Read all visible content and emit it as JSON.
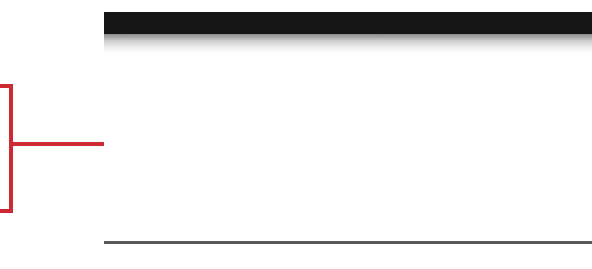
{
  "app": {
    "topbar": {
      "left_title": "",
      "left_subtitle": "",
      "right_text": ""
    },
    "center_links": [
      {
        "label": ""
      },
      {
        "label": ""
      }
    ],
    "footer": {
      "left_text": "",
      "right_text": ""
    }
  },
  "colors": {
    "callout": "#cd2b31",
    "topbar_bg": "#161616",
    "link": "#2a3358",
    "footer_rule": "#5a5a5a"
  }
}
